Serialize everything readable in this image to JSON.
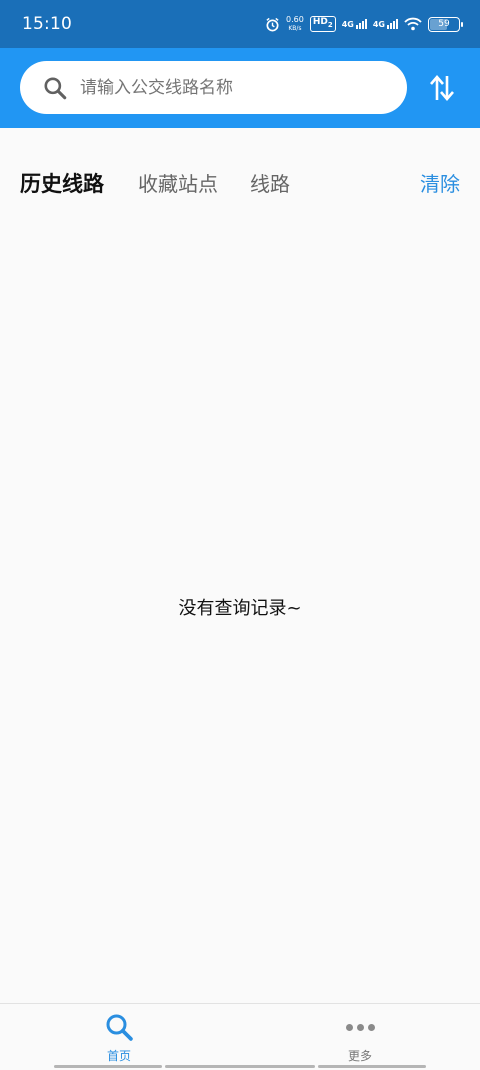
{
  "status_bar": {
    "time": "15:10",
    "speed_value": "0.60",
    "speed_unit": "KB/s",
    "hd_label": "HD",
    "hd_sub": "2",
    "net1": "4G",
    "net2": "4G",
    "battery": "59"
  },
  "search": {
    "placeholder": "请输入公交线路名称"
  },
  "tabs": [
    {
      "label": "历史线路",
      "active": true
    },
    {
      "label": "收藏站点",
      "active": false
    },
    {
      "label": "线路",
      "active": false
    }
  ],
  "clear_label": "清除",
  "empty_message": "没有查询记录~",
  "bottom_nav": [
    {
      "label": "首页",
      "icon": "search-icon",
      "active": true
    },
    {
      "label": "更多",
      "icon": "more-dots-icon",
      "active": false
    }
  ],
  "colors": {
    "status_bar": "#1a6fb8",
    "header": "#2196f3",
    "accent": "#2a8ee0"
  }
}
